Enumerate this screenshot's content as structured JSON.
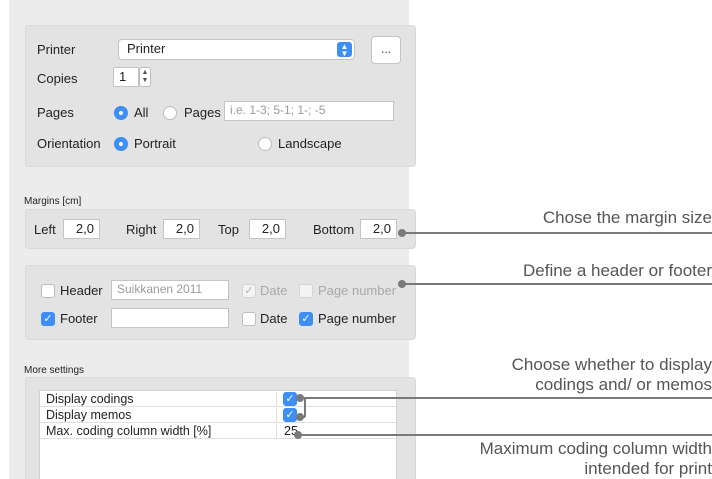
{
  "printer": {
    "label": "Printer",
    "value": "Printer",
    "more_label": "..."
  },
  "copies": {
    "label": "Copies",
    "value": "1"
  },
  "pages": {
    "label": "Pages",
    "all_label": "All",
    "pages_label": "Pages",
    "placeholder": "i.e. 1-3; 5-1; 1-; -5",
    "selected": "All"
  },
  "orientation": {
    "label": "Orientation",
    "portrait_label": "Portrait",
    "landscape_label": "Landscape",
    "selected": "Portrait"
  },
  "margins": {
    "section_label": "Margins [cm]",
    "left_label": "Left",
    "left_value": "2,0",
    "right_label": "Right",
    "right_value": "2,0",
    "top_label": "Top",
    "top_value": "2,0",
    "bottom_label": "Bottom",
    "bottom_value": "2,0"
  },
  "header_footer": {
    "header_label": "Header",
    "header_value": "Suikkanen 2011",
    "header_checked": false,
    "header_date_label": "Date",
    "header_date_checked": true,
    "header_page_label": "Page number",
    "header_page_checked": false,
    "footer_label": "Footer",
    "footer_value": "",
    "footer_checked": true,
    "footer_date_label": "Date",
    "footer_date_checked": false,
    "footer_page_label": "Page number",
    "footer_page_checked": true
  },
  "more_settings": {
    "section_label": "More settings",
    "rows": [
      {
        "label": "Display codings",
        "value": "✓"
      },
      {
        "label": "Display memos",
        "value": "✓"
      },
      {
        "label": "Max. coding column width [%]",
        "value": "25"
      }
    ]
  },
  "annotations": {
    "margin": "Chose the margin size",
    "header": "Define a header or footer",
    "display_line1": "Choose whether to display",
    "display_line2": "codings and/ or memos",
    "max_line1": "Maximum coding column width",
    "max_line2": "intended for print"
  },
  "colors": {
    "accent": "#3d8ff5",
    "panel": "#ececec",
    "group": "#e3e3e3",
    "callout": "#7a7a7a"
  }
}
